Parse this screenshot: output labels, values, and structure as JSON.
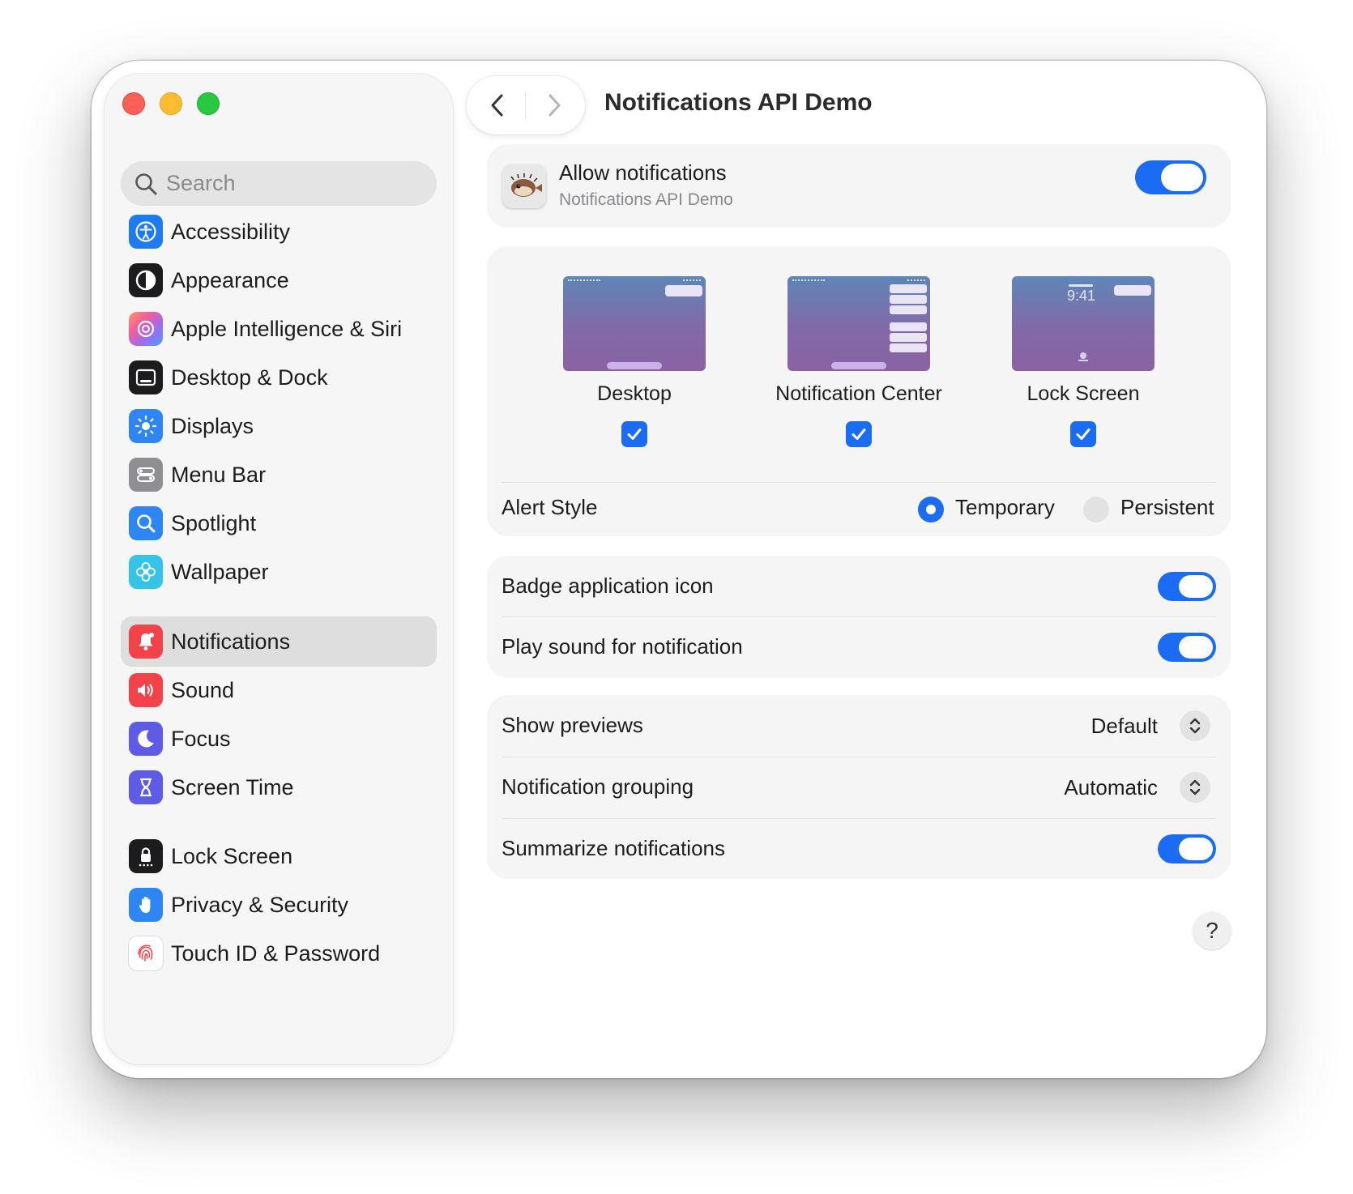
{
  "window": {
    "title": "Notifications API Demo"
  },
  "search": {
    "placeholder": "Search"
  },
  "sidebar": {
    "groups": [
      [
        {
          "label": "Accessibility",
          "icon": "accessibility-icon"
        },
        {
          "label": "Appearance",
          "icon": "appearance-icon"
        },
        {
          "label": "Apple Intelligence & Siri",
          "icon": "apple-intelligence-icon"
        },
        {
          "label": "Desktop & Dock",
          "icon": "desktop-dock-icon"
        },
        {
          "label": "Displays",
          "icon": "displays-icon"
        },
        {
          "label": "Menu Bar",
          "icon": "menu-bar-icon"
        },
        {
          "label": "Spotlight",
          "icon": "spotlight-icon"
        },
        {
          "label": "Wallpaper",
          "icon": "wallpaper-icon"
        }
      ],
      [
        {
          "label": "Notifications",
          "icon": "notifications-icon",
          "selected": true
        },
        {
          "label": "Sound",
          "icon": "sound-icon"
        },
        {
          "label": "Focus",
          "icon": "focus-icon"
        },
        {
          "label": "Screen Time",
          "icon": "screen-time-icon"
        }
      ],
      [
        {
          "label": "Lock Screen",
          "icon": "lock-screen-icon"
        },
        {
          "label": "Privacy & Security",
          "icon": "privacy-icon"
        },
        {
          "label": "Touch ID & Password",
          "icon": "touch-id-icon"
        }
      ]
    ]
  },
  "allow": {
    "title": "Allow notifications",
    "subtitle": "Notifications API Demo",
    "app_icon": "pufferfish-app-icon",
    "enabled": true
  },
  "previews": {
    "items": [
      {
        "label": "Desktop",
        "checked": true
      },
      {
        "label": "Notification Center",
        "checked": true
      },
      {
        "label": "Lock Screen",
        "checked": true,
        "clock": "9:41"
      }
    ]
  },
  "alert_style": {
    "label": "Alert Style",
    "options": [
      {
        "label": "Temporary",
        "selected": true
      },
      {
        "label": "Persistent",
        "selected": false
      }
    ]
  },
  "badges": {
    "badge_label": "Badge application icon",
    "badge_on": true,
    "sound_label": "Play sound for notification",
    "sound_on": true
  },
  "options": {
    "previews_label": "Show previews",
    "previews_value": "Default",
    "grouping_label": "Notification grouping",
    "grouping_value": "Automatic",
    "summarize_label": "Summarize notifications",
    "summarize_on": true
  },
  "help": {
    "label": "?"
  },
  "colors": {
    "accent": "#1a6cf5",
    "card": "#f5f5f5",
    "sidebar": "#f6f6f6"
  }
}
